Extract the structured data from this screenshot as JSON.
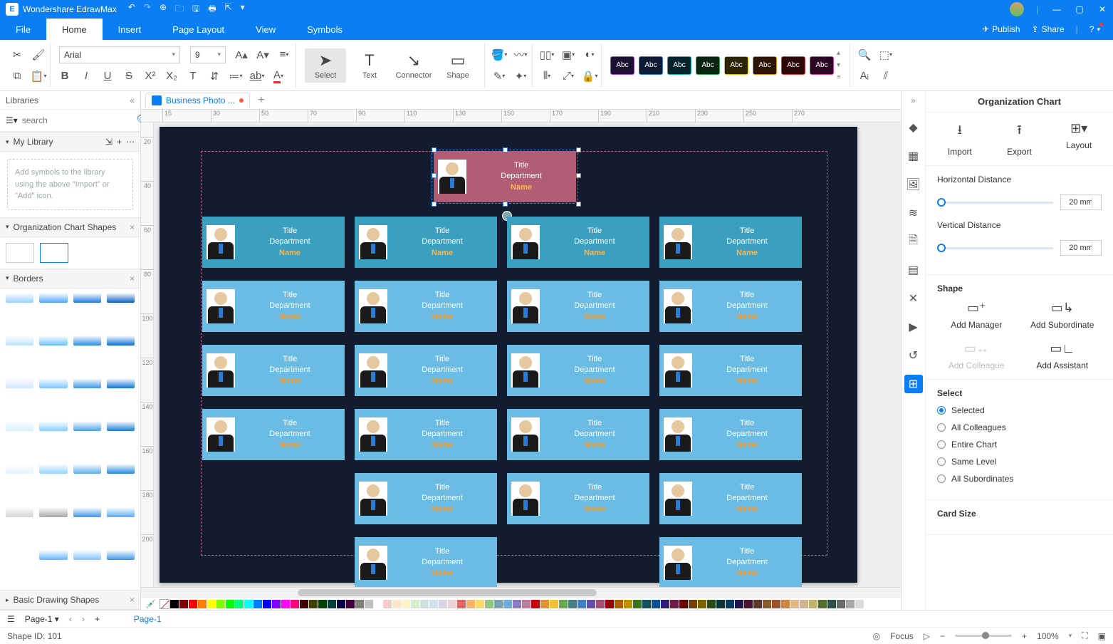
{
  "titlebar": {
    "appname": "Wondershare EdrawMax"
  },
  "tabs": {
    "file": "File",
    "home": "Home",
    "insert": "Insert",
    "pagelayout": "Page Layout",
    "view": "View",
    "symbols": "Symbols"
  },
  "topright": {
    "publish": "Publish",
    "share": "Share"
  },
  "ribbon": {
    "font": "Arial",
    "size": "9",
    "tool_select": "Select",
    "tool_text": "Text",
    "tool_connector": "Connector",
    "tool_shape": "Shape",
    "styles": [
      {
        "bg": "#1b1030",
        "bd": "#a04ad8"
      },
      {
        "bg": "#0d1a33",
        "bd": "#2a7bd4"
      },
      {
        "bg": "#07232b",
        "bd": "#18b3b3"
      },
      {
        "bg": "#0b2412",
        "bd": "#2fae4e"
      },
      {
        "bg": "#2b2407",
        "bd": "#e2b90f"
      },
      {
        "bg": "#2b1405",
        "bd": "#e8861a"
      },
      {
        "bg": "#2b0707",
        "bd": "#e23b3b"
      },
      {
        "bg": "#2a0720",
        "bd": "#d63fa2"
      }
    ],
    "style_label": "Abc"
  },
  "leftpanel": {
    "libraries": "Libraries",
    "search_placeholder": "search",
    "mylib": "My Library",
    "mylib_hint": "Add symbols to the library using the above \"Import\" or \"Add\" icon.",
    "orgshapes": "Organization Chart Shapes",
    "borders": "Borders",
    "basicshapes": "Basic Drawing Shapes",
    "border_colors": [
      "#9ad0ff",
      "#4da3ff",
      "#1e7be0",
      "#0a5bbf",
      "#bfe3ff",
      "#6ec1ff",
      "#2a8de6",
      "#0a6ed1",
      "#cfe9ff",
      "#7cc6ff",
      "#3a97e8",
      "#1276d6",
      "#d8efff",
      "#88ccff",
      "#4aa2eb",
      "#1a80da",
      "#e2f3ff",
      "#95d2ff",
      "#5aaeee",
      "#2288de",
      "#d3d3d3",
      "#a8a8a8",
      "#3d94e4",
      "#5aaeee",
      "#ffffff",
      "#62b4ff",
      "#7ec2ff",
      "#3a97e8"
    ]
  },
  "doc": {
    "tabname": "Business Photo ..."
  },
  "ruler_h": [
    15,
    30,
    50,
    70,
    90,
    110,
    130,
    150,
    170,
    190,
    210,
    230,
    250,
    270
  ],
  "ruler_v": [
    20,
    40,
    60,
    80,
    100,
    120,
    140,
    160,
    180,
    200
  ],
  "card": {
    "title": "Title",
    "dept": "Department",
    "name": "Name"
  },
  "rightpanel": {
    "title": "Organization Chart",
    "import": "Import",
    "export": "Export",
    "layout": "Layout",
    "hdist_label": "Horizontal Distance",
    "vdist_label": "Vertical Distance",
    "hdist": "20 mm",
    "vdist": "20 mm",
    "shape": "Shape",
    "add_manager": "Add Manager",
    "add_sub": "Add Subordinate",
    "add_coll": "Add Colleague",
    "add_asst": "Add Assistant",
    "select": "Select",
    "r_selected": "Selected",
    "r_allcoll": "All Colleagues",
    "r_entire": "Entire Chart",
    "r_same": "Same Level",
    "r_allsub": "All Subordinates",
    "cardsize": "Card Size"
  },
  "colorbar": [
    "#000000",
    "#7f0000",
    "#ff0000",
    "#ff7f00",
    "#ffff00",
    "#7fff00",
    "#00ff00",
    "#00ff7f",
    "#00ffff",
    "#007fff",
    "#0000ff",
    "#7f00ff",
    "#ff00ff",
    "#ff007f",
    "#400000",
    "#404000",
    "#004000",
    "#004040",
    "#000040",
    "#400040",
    "#808080",
    "#c0c0c0",
    "#ffffff",
    "#f4cccc",
    "#fce5cd",
    "#fff2cc",
    "#d9ead3",
    "#d0e0e3",
    "#cfe2f3",
    "#d9d2e9",
    "#ead1dc",
    "#e06666",
    "#f6b26b",
    "#ffd966",
    "#93c47d",
    "#76a5af",
    "#6fa8dc",
    "#8e7cc3",
    "#c27ba0",
    "#cc0000",
    "#e69138",
    "#f1c232",
    "#6aa84f",
    "#45818e",
    "#3d85c6",
    "#674ea7",
    "#a64d79",
    "#990000",
    "#b45f06",
    "#bf9000",
    "#38761d",
    "#134f5c",
    "#0b5394",
    "#351c75",
    "#741b47",
    "#660000",
    "#783f04",
    "#7f6000",
    "#274e13",
    "#0c343d",
    "#073763",
    "#20124d",
    "#4c1130",
    "#5b3a29",
    "#8b5a2b",
    "#a0522d",
    "#cd853f",
    "#deb887",
    "#d2b48c",
    "#bdb76b",
    "#556b2f",
    "#2f4f4f",
    "#696969",
    "#a9a9a9",
    "#dcdcdc"
  ],
  "pagebar": {
    "page": "Page-1",
    "pagetab": "Page-1"
  },
  "status": {
    "shapeid": "Shape ID: 101",
    "focus": "Focus",
    "zoom": "100%"
  }
}
